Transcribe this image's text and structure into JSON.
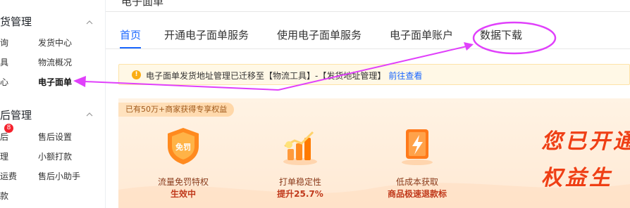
{
  "sidebar": {
    "sections": [
      {
        "title": "货管理",
        "items": [
          {
            "left": "询",
            "right": "发货中心"
          },
          {
            "left": "具",
            "right": "物流概况"
          },
          {
            "left": "心",
            "right": "电子面单"
          }
        ]
      },
      {
        "title": "后管理",
        "badge": "8",
        "items": [
          {
            "left": "后",
            "right": "售后设置"
          },
          {
            "left": "理",
            "right": "小额打款"
          },
          {
            "left": "运费",
            "right": "售后小助手"
          },
          {
            "left": "款",
            "right": ""
          }
        ]
      }
    ]
  },
  "header": {
    "partial_title": "电子面单"
  },
  "tabs": [
    {
      "label": "首页",
      "active": true
    },
    {
      "label": "开通电子面单服务",
      "active": false
    },
    {
      "label": "使用电子面单服务",
      "active": false
    },
    {
      "label": "电子面单账户",
      "active": false
    },
    {
      "label": "数据下载",
      "active": false
    }
  ],
  "notice": {
    "icon": "!",
    "text": "电子面单发货地址管理已迁移至【物流工具】-【发货地址管理】",
    "link": "前往查看"
  },
  "promo": {
    "pill": "已有50万+商家获得专享权益",
    "benefits": [
      {
        "title": "流量免罚特权",
        "sub": "生效中",
        "icon_text": "免罚"
      },
      {
        "title": "打单稳定性",
        "sub": "提升25.7%"
      },
      {
        "title": "低成本获取",
        "sub": "商品极速退款标"
      }
    ],
    "headline_1": "您已开通",
    "headline_2": "权益生"
  },
  "colors": {
    "accent": "#1966ff",
    "annotation": "#e040fb",
    "badge": "#f5222d",
    "promo_text": "#ef3f15"
  }
}
